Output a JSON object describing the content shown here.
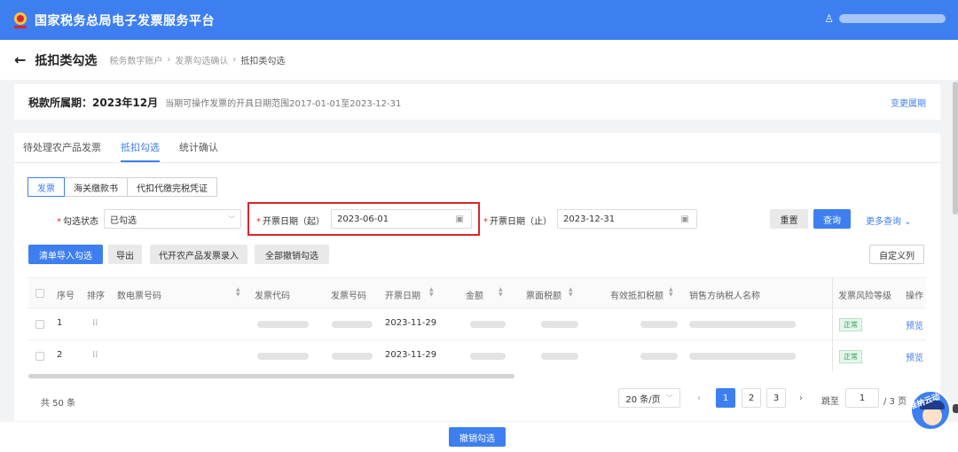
{
  "app": {
    "title": "国家税务总局电子发票服务平台"
  },
  "header": {
    "user_icon": "user-icon"
  },
  "page": {
    "back": "←",
    "title": "抵扣类勾选",
    "breadcrumb": [
      "税务数字账户",
      "发票勾选确认",
      "抵扣类勾选"
    ],
    "sep": "›"
  },
  "period": {
    "label": "税款所属期：",
    "value": "2023年12月",
    "hint": "当期可操作发票的开具日期范围2017-01-01至2023-12-31",
    "change": "变更属期"
  },
  "tabs": [
    "待处理农产品发票",
    "抵扣勾选",
    "统计确认"
  ],
  "segments": [
    "发票",
    "海关缴款书",
    "代扣代缴完税凭证"
  ],
  "filters": {
    "status_label": "勾选状态",
    "status_value": "已勾选",
    "start_label": "开票日期（起）",
    "start_value": "2023-06-01",
    "end_label": "开票日期（止）",
    "end_value": "2023-12-31",
    "reset": "重置",
    "query": "查询",
    "more": "更多查询"
  },
  "actions": {
    "import": "清单导入勾选",
    "export": "导出",
    "agri_entry": "代开农产品发票录入",
    "cancel_all": "全部撤销勾选",
    "custom_cols": "自定义列"
  },
  "table": {
    "headers": {
      "seq": "序号",
      "sort": "排序",
      "digital_no": "数电票号码",
      "code": "发票代码",
      "number": "发票号码",
      "date": "开票日期",
      "amount": "金额",
      "tax": "票面税额",
      "valid_tax": "有效抵扣税额",
      "seller": "销售方纳税人名称",
      "risk": "发票风险等级",
      "op": "操作"
    },
    "rows": [
      {
        "seq": "1",
        "sort_icon": "⁞⁞",
        "date": "2023-11-29",
        "risk": "正常",
        "op": "预览"
      },
      {
        "seq": "2",
        "sort_icon": "⁞⁞",
        "date": "2023-11-29",
        "risk": "正常",
        "op": "预览"
      }
    ]
  },
  "pager": {
    "total": "共 50 条",
    "page_size": "20 条/页",
    "pages": [
      "1",
      "2",
      "3"
    ],
    "current": "1",
    "prev": "‹",
    "next": "›",
    "jump_label": "跳至",
    "jump_value": "1",
    "page_total": "/ 3 页"
  },
  "bottom": {
    "cancel": "撤销勾选"
  },
  "mascot": {
    "label": "准纳云动"
  },
  "colors": {
    "primary": "#3d7ff0",
    "highlight": "#d8262b",
    "ok": "#2e9d56"
  }
}
